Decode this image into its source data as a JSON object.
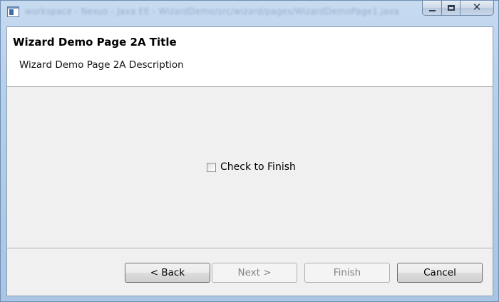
{
  "window": {
    "ghost_title": "workspace - Nexus - Java EE - WizardDemo/src/wizard/pages/WizardDemoPage1.java",
    "icons": {
      "app": "app-window-icon",
      "minimize": "minimize-icon",
      "maximize": "maximize-icon",
      "close": "close-icon"
    },
    "close_glyph": "✕"
  },
  "header": {
    "title": "Wizard Demo Page 2A Title",
    "description": "Wizard Demo Page 2A Description"
  },
  "content": {
    "checkbox_label": "Check to Finish",
    "checkbox_checked": false
  },
  "buttons": {
    "back": "< Back",
    "next": "Next >",
    "finish": "Finish",
    "cancel": "Cancel"
  },
  "button_states": {
    "back_enabled": true,
    "next_enabled": false,
    "finish_enabled": false,
    "cancel_enabled": true
  }
}
